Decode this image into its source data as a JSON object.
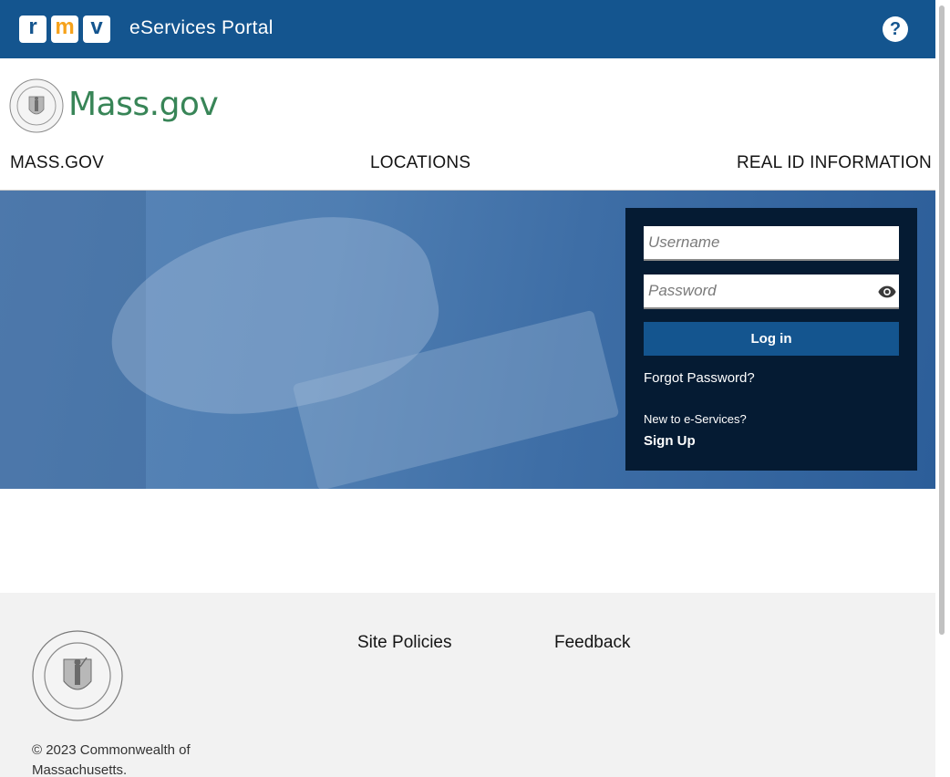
{
  "topbar": {
    "logo_letters": [
      "r",
      "m",
      "v"
    ],
    "title": "eServices Portal",
    "help_label": "?"
  },
  "header": {
    "brand": "Mass.gov",
    "nav": [
      {
        "label": "MASS.GOV"
      },
      {
        "label": "LOCATIONS"
      },
      {
        "label": "REAL ID INFORMATION"
      }
    ]
  },
  "login": {
    "username_placeholder": "Username",
    "password_placeholder": "Password",
    "login_label": "Log in",
    "forgot_label": "Forgot Password?",
    "new_to_label": "New to e-Services?",
    "signup_label": "Sign Up"
  },
  "footer": {
    "links": [
      {
        "label": "Site Policies"
      },
      {
        "label": "Feedback"
      }
    ],
    "copyright": "© 2023 Commonwealth of Massachusetts."
  },
  "colors": {
    "brand_blue": "#14558f",
    "panel_dark": "#051b33",
    "mass_green": "#388557",
    "rmv_orange": "#f6a21b"
  },
  "icons": {
    "help": "question-circle-icon",
    "password_toggle": "eye-icon",
    "seal": "massachusetts-seal-icon"
  }
}
